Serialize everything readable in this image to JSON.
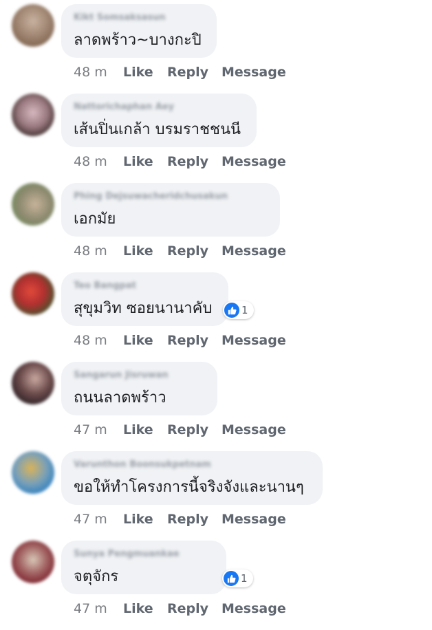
{
  "comments": [
    {
      "name": "Kikt Somsaksasun",
      "text": "ลาดพร้าว~บางกะปิ",
      "time": "48 m",
      "like_label": "Like",
      "reply_label": "Reply",
      "message_label": "Message",
      "avatar_colors": [
        "#8a6f5a",
        "#c9b2a0"
      ]
    },
    {
      "name": "Nattorichaphan Aey",
      "text": "เส้นปิ่นเกล้า บรมราชชนนี",
      "time": "48 m",
      "like_label": "Like",
      "reply_label": "Reply",
      "message_label": "Message",
      "avatar_colors": [
        "#3a2a2a",
        "#d7b8c0"
      ]
    },
    {
      "name": "Phing Dejsuwacheridchusakun",
      "text": "เอกมัย",
      "time": "48 m",
      "like_label": "Like",
      "reply_label": "Reply",
      "message_label": "Message",
      "avatar_colors": [
        "#6f8a5a",
        "#c7b39a"
      ]
    },
    {
      "name": "Teo Bangpat",
      "text": "สุขุมวิท ซอยนานาคับ",
      "time": "48 m",
      "like_label": "Like",
      "reply_label": "Reply",
      "message_label": "Message",
      "reaction_count": "1",
      "avatar_colors": [
        "#b23030",
        "#2f5a2a"
      ]
    },
    {
      "name": "Sangarun Jisruwan",
      "text": "ถนนลาดพร้าว",
      "time": "47 m",
      "like_label": "Like",
      "reply_label": "Reply",
      "message_label": "Message",
      "avatar_colors": [
        "#2a1f25",
        "#c9a7a0"
      ]
    },
    {
      "name": "Varunthon Boonsukpetnam",
      "text": "ขอให้ทำโครงการนี้จริงจังและนานๆ",
      "time": "47 m",
      "like_label": "Like",
      "reply_label": "Reply",
      "message_label": "Message",
      "avatar_colors": [
        "#2b7fc1",
        "#d9b35a"
      ]
    },
    {
      "name": "Sunya Pengmuankae",
      "text": "จตุจักร",
      "time": "47 m",
      "like_label": "Like",
      "reply_label": "Reply",
      "message_label": "Message",
      "reaction_count": "1",
      "avatar_colors": [
        "#7a1f2a",
        "#d8c7b6"
      ]
    }
  ],
  "colors": {
    "bubble": "#f0f2f5",
    "like_blue": "#1877f2"
  }
}
